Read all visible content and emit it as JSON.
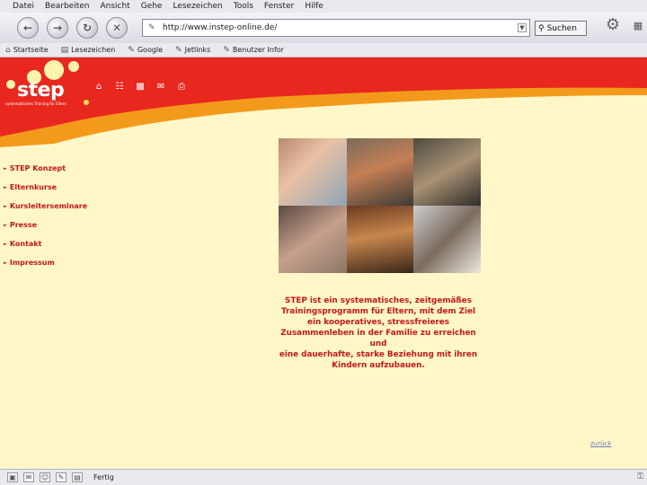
{
  "browser": {
    "menu": [
      "Datei",
      "Bearbeiten",
      "Ansicht",
      "Gehe",
      "Lesezeichen",
      "Tools",
      "Fenster",
      "Hilfe"
    ],
    "address_url": "http://www.instep-online.de/",
    "search_label": "Suchen",
    "bookmarks": [
      "Startseite",
      "Lesezeichen",
      "Google",
      "Jetlinks",
      "Benutzer Infor"
    ],
    "status_text": "Fertig"
  },
  "site": {
    "logo_text": "step",
    "logo_subtitle": "systematisches Training für Eltern",
    "nav": [
      "STEP Konzept",
      "Elternkurse",
      "Kursleiterseminare",
      "Presse",
      "Kontakt",
      "Impressum"
    ],
    "tagline": [
      "STEP ist ein systematisches, zeitgemäßes",
      "Trainingsprogramm für Eltern, mit dem Ziel",
      "ein kooperatives, stressfreieres",
      "Zusammenleben in der Familie zu erreichen",
      "und",
      "eine dauerhafte, starke Beziehung mit ihren",
      "Kindern aufzubauen."
    ],
    "back_link": "zurück"
  },
  "colors": {
    "brand_red": "#e8281e",
    "accent_orange": "#f39a1c",
    "page_background": "#fff7c8",
    "text_red": "#c4161c"
  },
  "icons": {
    "top_icons": [
      "home-icon",
      "cart-icon",
      "sitemap-icon",
      "email-icon",
      "print-icon"
    ]
  }
}
